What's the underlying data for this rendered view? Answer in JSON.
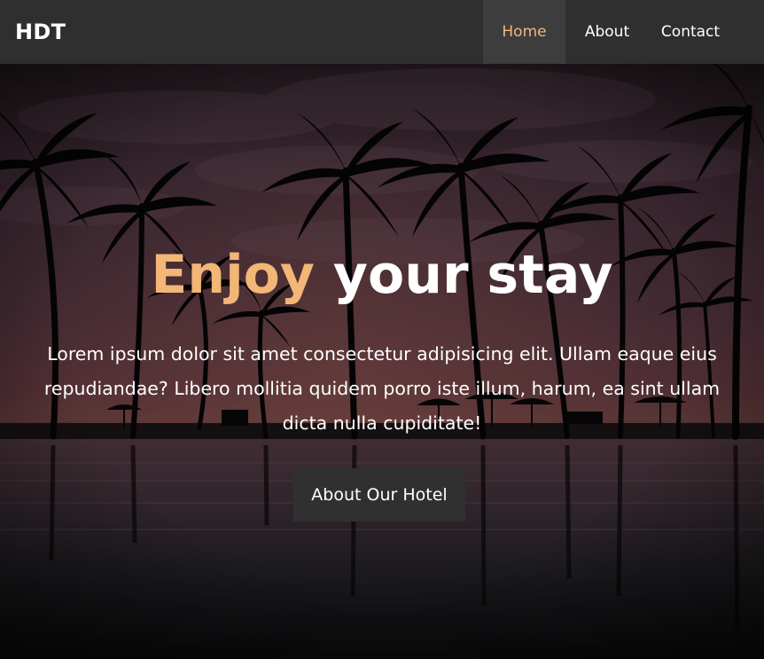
{
  "navbar": {
    "brand": "HDT",
    "links": [
      {
        "label": "Home",
        "active": true
      },
      {
        "label": "About",
        "active": false
      },
      {
        "label": "Contact",
        "active": false
      }
    ]
  },
  "hero": {
    "title_accent": "Enjoy",
    "title_rest": " your stay",
    "description": "Lorem ipsum dolor sit amet consectetur adipisicing elit. Ullam eaque eius repudiandae? Libero mollitia quidem porro iste illum, harum, ea sint ullam dicta nulla cupiditate!",
    "button_label": "About Our Hotel",
    "background_icon": "palm-beach-sunset-photo"
  },
  "colors": {
    "accent": "#f2b677",
    "navbar_bg": "#2f2f2f",
    "active_tab_bg": "#3d3d3d",
    "button_bg": "#303030",
    "text": "#ffffff"
  }
}
